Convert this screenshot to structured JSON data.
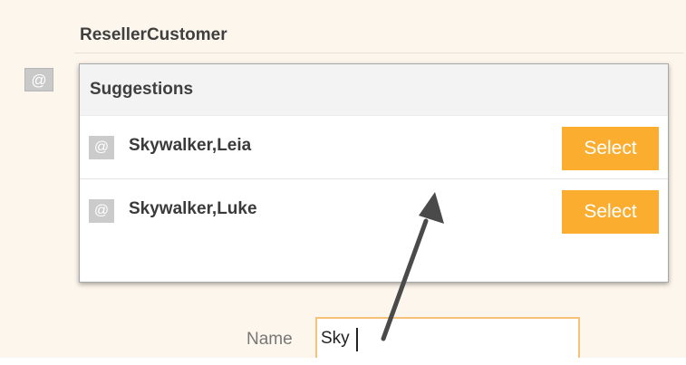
{
  "section": {
    "title": "ResellerCustomer",
    "badge_icon": "at-icon",
    "badge_glyph": "@"
  },
  "suggestions": {
    "header": "Suggestions",
    "items": [
      {
        "icon": "at-icon",
        "glyph": "@",
        "name": "Skywalker,Leia",
        "select_label": "Select"
      },
      {
        "icon": "at-icon",
        "glyph": "@",
        "name": "Skywalker,Luke",
        "select_label": "Select"
      }
    ]
  },
  "name_field": {
    "label": "Name",
    "value": "Sky"
  },
  "colors": {
    "background": "#fdf6ec",
    "select_button": "#fbad2f",
    "input_border": "#f6c27a",
    "annotation_arrow": "#4a4a4a"
  }
}
